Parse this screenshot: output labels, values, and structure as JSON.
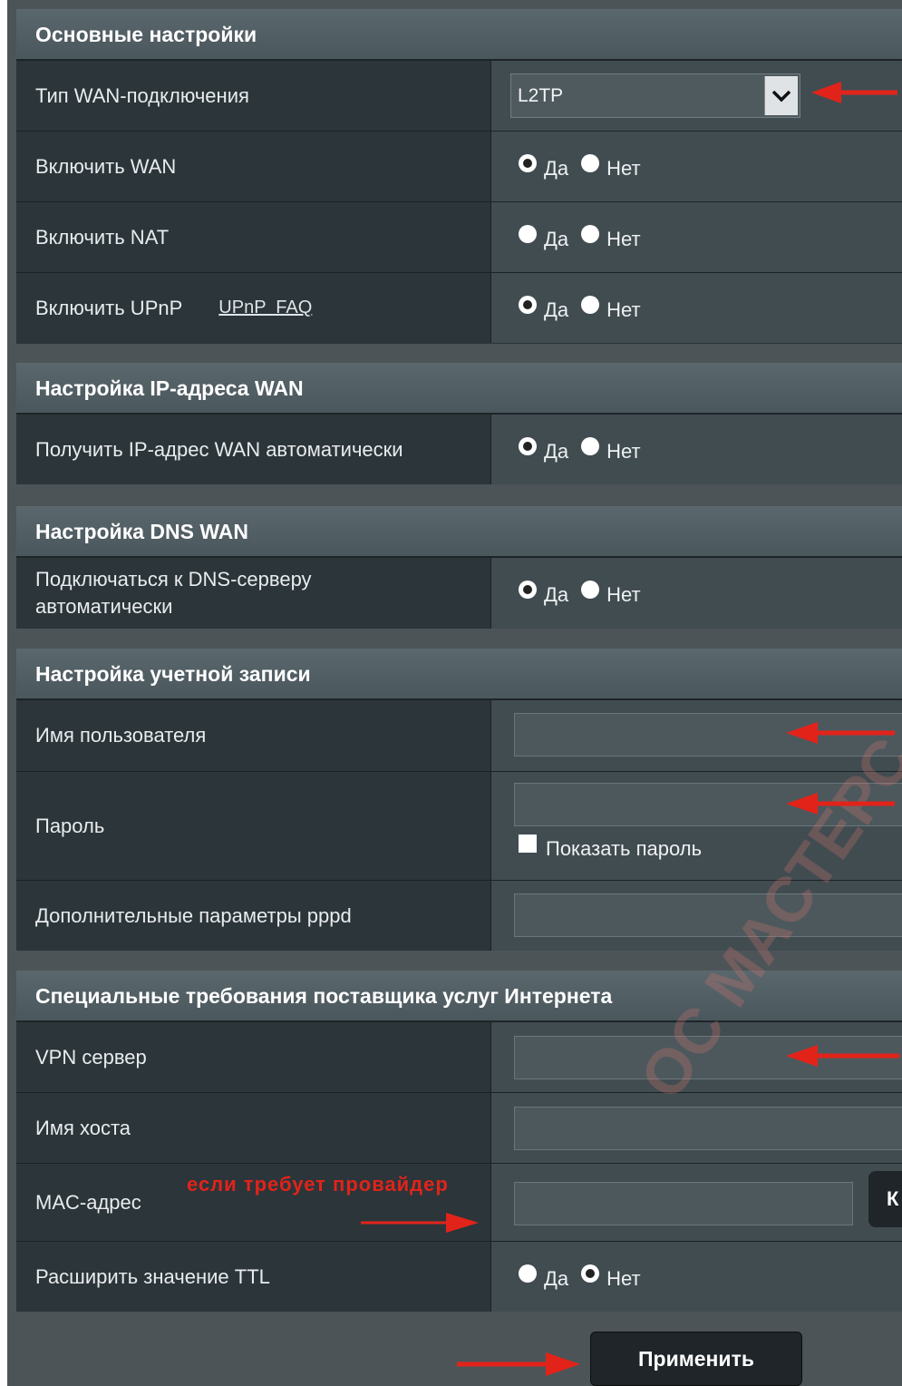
{
  "sections": {
    "basic": {
      "title": "Основные настройки",
      "wan_type_label": "Тип WAN-подключения",
      "wan_type_value": "L2TP",
      "enable_wan_label": "Включить WAN",
      "enable_nat_label": "Включить NAT",
      "enable_upnp_label": "Включить UPnP",
      "upnp_faq": "UPnP  FAQ"
    },
    "ip": {
      "title": "Настройка IP-адреса WAN",
      "auto_ip_label": "Получить IP-адрес WAN автоматически"
    },
    "dns": {
      "title": "Настройка DNS WAN",
      "auto_dns_label_line1": "Подключаться к DNS-серверу",
      "auto_dns_label_line2": "автоматически"
    },
    "account": {
      "title": "Настройка учетной записи",
      "username_label": "Имя пользователя",
      "password_label": "Пароль",
      "show_password": "Показать пароль",
      "pppd_label": "Дополнительные параметры pppd"
    },
    "isp": {
      "title": "Специальные требования поставщика услуг Интернета",
      "vpn_label": "VPN сервер",
      "host_label": "Имя хоста",
      "mac_label": "MAC-адрес",
      "mac_note": "если требует провайдер",
      "mac_button": "К",
      "ttl_label": "Расширить значение TTL"
    }
  },
  "radio": {
    "yes": "Да",
    "no": "Нет"
  },
  "apply_button": "Применить",
  "watermark": "ОС МАСТЕРС",
  "colors": {
    "accent_arrow": "#e2231a",
    "header_bg": "#536066",
    "row_label_bg": "#2c3539",
    "row_value_bg": "#414c51"
  }
}
